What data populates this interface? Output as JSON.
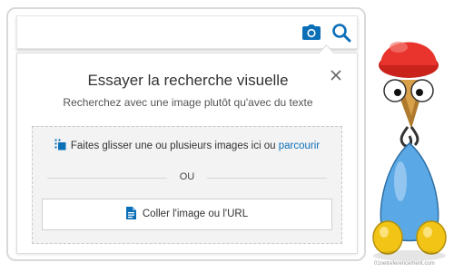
{
  "searchbar": {
    "camera_icon": "camera-icon",
    "search_icon": "magnifier-icon"
  },
  "panel": {
    "title": "Essayer la recherche visuelle",
    "subtitle": "Recherchez avec une image plutôt qu'avec du texte",
    "close_icon": "close-x-icon",
    "dropzone": {
      "drag_text": "Faites glisser une ou plusieurs images ici ou ",
      "browse_link": "parcourir",
      "or_text": "OU",
      "paste_label": "Coller l'image ou l'URL"
    }
  },
  "watermark": "01netreferencement.com",
  "colors": {
    "accent_blue": "#0b6fb8",
    "mascot_hat": "#e8342c",
    "mascot_body": "#5aa9e6",
    "mascot_feet": "#f2c415"
  }
}
